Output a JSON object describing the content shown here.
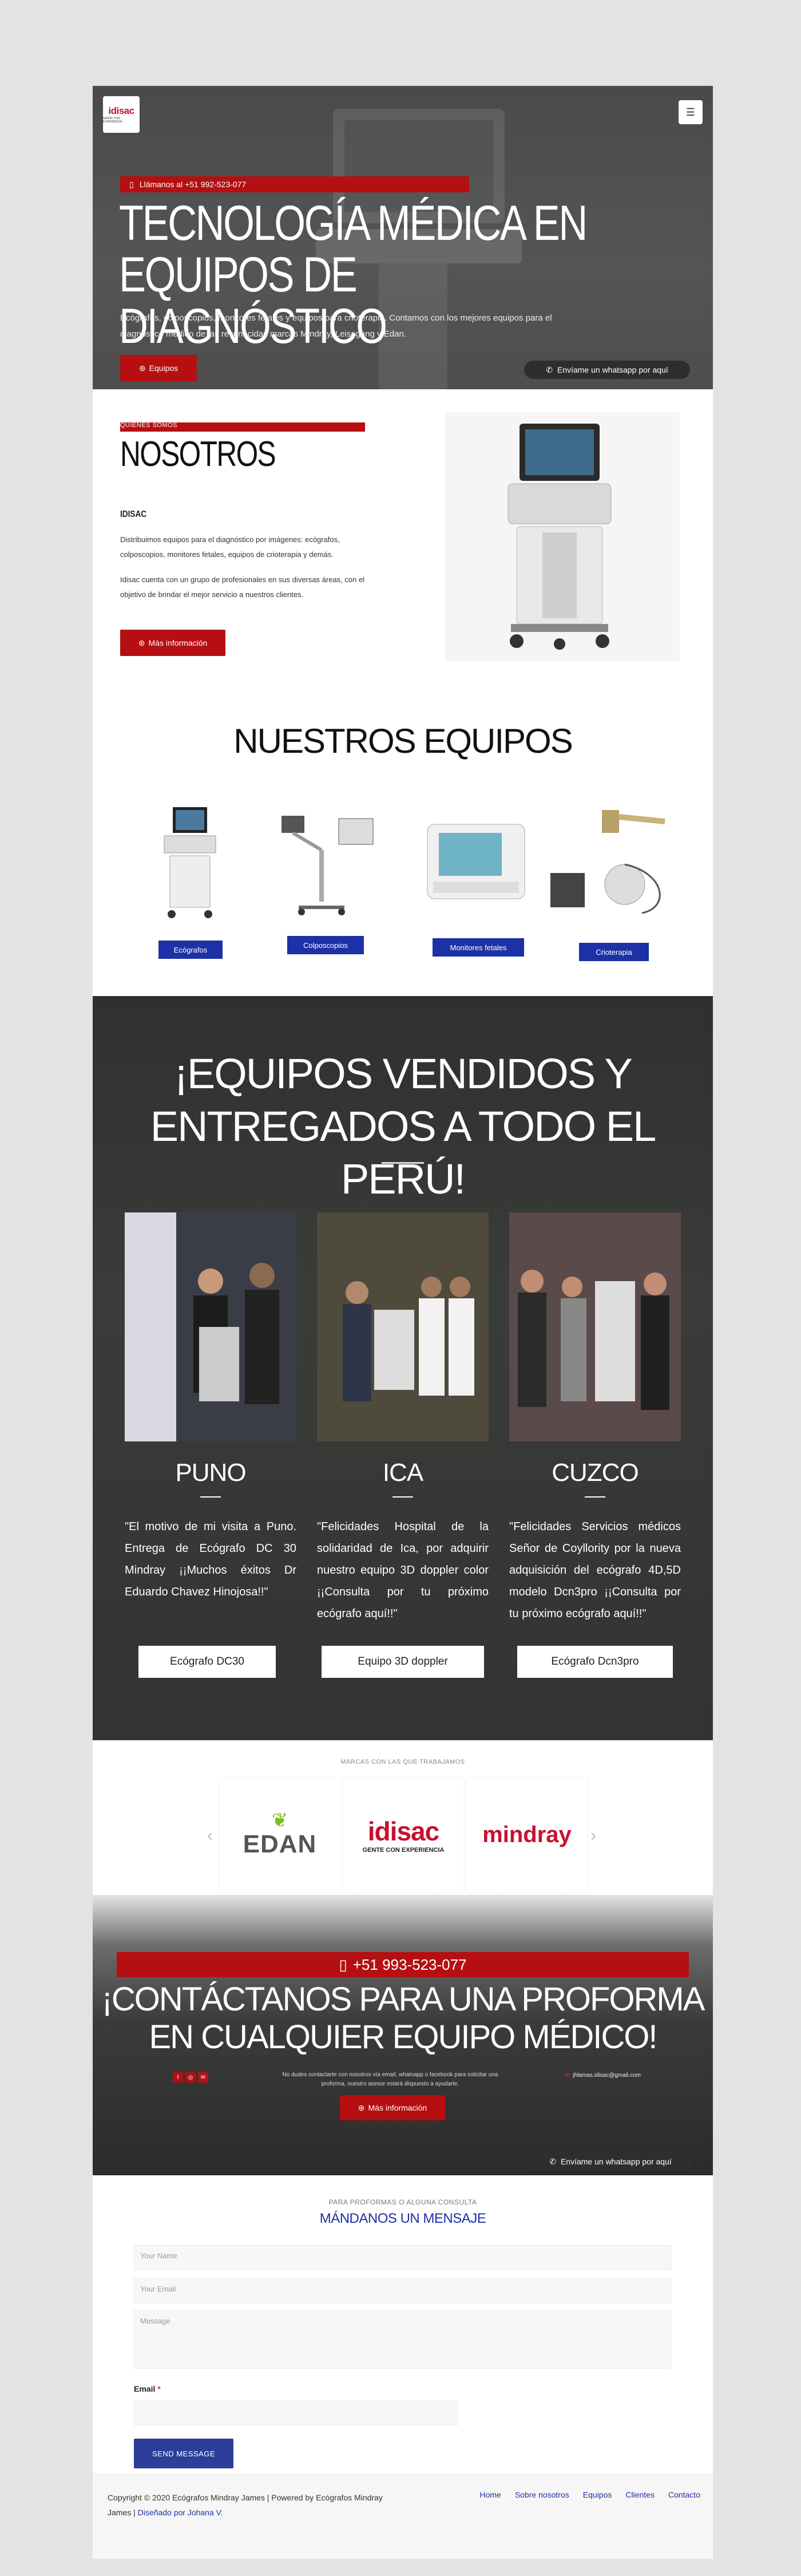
{
  "header": {
    "logo_main": "idisac",
    "logo_sub": "GENTE CON EXPERIENCIA",
    "menu_icon": "hamburger-icon"
  },
  "hero": {
    "phone_text": "Llámanos al +51 992-523-077",
    "title": "TECNOLOGÍA MÉDICA EN EQUIPOS DE DIAGNÓSTICO",
    "lead": "Ecógrafos, colposcopios, monitores fetales y equipos para crioterapia. Contamos con los mejores equipos para el diagnóstico médico de las reconocidas marcas Mindray, Leisegang y Edan.",
    "button_label": "Equipos",
    "whatsapp_label": "Envíame un whatsapp por aquí"
  },
  "about": {
    "tag": "QUIÉNES SOMOS",
    "title": "NOSOTROS",
    "subtitle": "IDISAC",
    "p1": "Distribuimos equipos para el diagnóstico por imágenes: ecógrafos, colposcopios, monitores fetales, equipos de crioterapia y demás.",
    "p2": "Idisac cuenta con un grupo de profesionales en sus diversas áreas, con el objetivo de brindar el mejor servicio a nuestros clientes.",
    "button_label": "Más información"
  },
  "equipment": {
    "title": "NUESTROS EQUIPOS",
    "items": [
      {
        "label": "Ecógrafos"
      },
      {
        "label": "Colposcopios"
      },
      {
        "label": "Monitores fetales"
      },
      {
        "label": "Crioterapia"
      }
    ]
  },
  "sold": {
    "title": "¡EQUIPOS VENDIDOS Y ENTREGADOS A TODO EL PERÚ!",
    "cities": [
      {
        "name": "PUNO",
        "text": "\"El motivo de mi visita a Puno. Entrega de Ecógrafo DC 30 Mindray ¡¡Muchos éxitos Dr Eduardo Chavez Hinojosa!!\"",
        "button": "Ecógrafo DC30"
      },
      {
        "name": "ICA",
        "text": "\"Felicidades Hospital de la solidaridad de Ica, por adquirir nuestro equipo 3D doppler color ¡¡Consulta por tu próximo ecógrafo aquí!!\"",
        "button": "Equipo 3D doppler"
      },
      {
        "name": "CUZCO",
        "text": "\"Felicidades Servicios médicos Señor de Coyllority por la nueva adquisición del ecógrafo 4D,5D modelo Dcn3pro ¡¡Consulta por tu próximo ecógrafo aquí!!\"",
        "button": "Ecógrafo Dcn3pro"
      }
    ]
  },
  "brands": {
    "label": "MARCAS CON LAS QUE TRABAJAMOS",
    "items": [
      {
        "name": "EDAN",
        "sub": ""
      },
      {
        "name": "idisac",
        "sub": "GENTE CON EXPERIENCIA"
      },
      {
        "name": "mindray",
        "sub": ""
      }
    ],
    "prev": "‹",
    "next": "›"
  },
  "cta": {
    "phone": "+51 993-523-077",
    "title": "¡CONTÁCTANOS PARA UNA PROFORMA EN CUALQUIER EQUIPO MÉDICO!",
    "note": "No dudes contactarte con nosotros vía email, whatsapp o facebook para solicitar una proforma, nuestro asesor estará dispuesto a ayudarte.",
    "email": "jhlamas.idisac@gmail.com",
    "button_label": "Más información",
    "whatsapp_label": "Envíame un whatsapp por aquí",
    "social": [
      "f",
      "◎",
      "✉"
    ]
  },
  "message": {
    "pre": "PARA PROFORMAS O ALGUNA CONSULTA",
    "title": "MÁNDANOS UN MENSAJE",
    "name_placeholder": "Your Name",
    "email_placeholder": "Your Email",
    "message_placeholder": "Message",
    "email_label": "Email",
    "required_mark": "*",
    "send_label": "SEND MESSAGE"
  },
  "footer": {
    "copy": "Copyright © 2020 Ecógrafos Mindray James | Powered by Ecógrafos Mindray James |",
    "designer": "Diseñado por Johana V.",
    "links": [
      "Home",
      "Sobre nosotros",
      "Equipos",
      "Clientes",
      "Contacto"
    ]
  },
  "colors": {
    "brand_red": "#b50f12",
    "brand_blue": "#1c31a5"
  }
}
